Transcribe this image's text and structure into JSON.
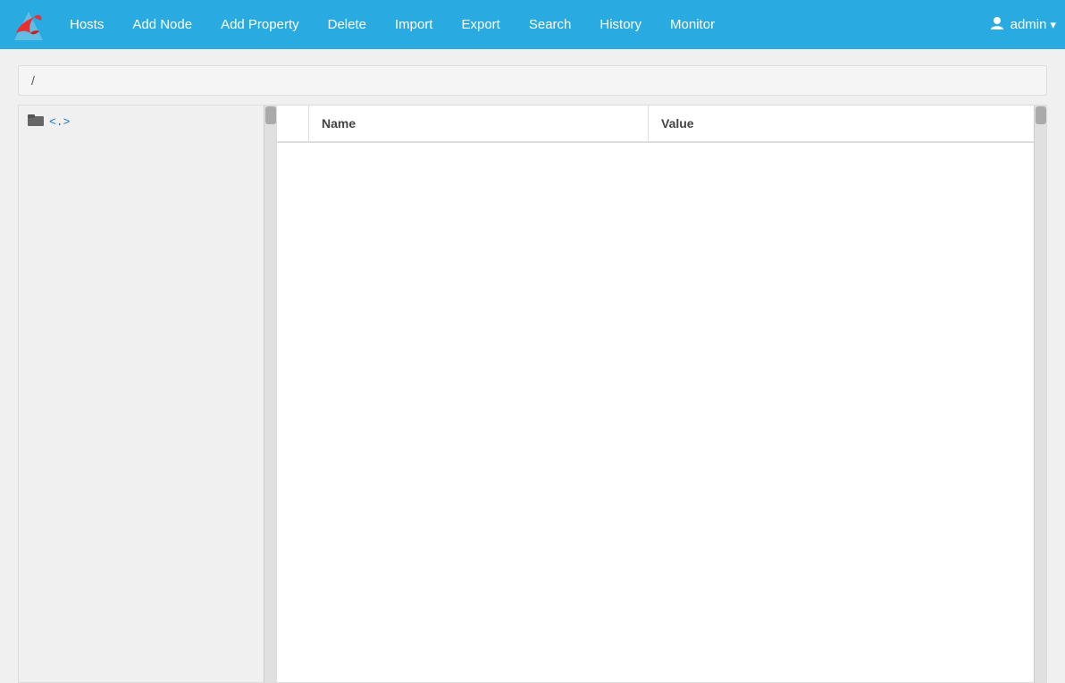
{
  "navbar": {
    "items": [
      {
        "label": "Hosts",
        "id": "hosts"
      },
      {
        "label": "Add Node",
        "id": "add-node"
      },
      {
        "label": "Add Property",
        "id": "add-property"
      },
      {
        "label": "Delete",
        "id": "delete"
      },
      {
        "label": "Import",
        "id": "import"
      },
      {
        "label": "Export",
        "id": "export"
      },
      {
        "label": "Search",
        "id": "search"
      },
      {
        "label": "History",
        "id": "history"
      },
      {
        "label": "Monitor",
        "id": "monitor"
      }
    ],
    "user": {
      "name": "admin",
      "dropdown_icon": "▾"
    }
  },
  "breadcrumb": {
    "path": "/"
  },
  "left_panel": {
    "tree_node": {
      "icon": "🗀",
      "label": "<.>"
    }
  },
  "table": {
    "columns": [
      {
        "id": "name",
        "label": "Name"
      },
      {
        "id": "value",
        "label": "Value"
      }
    ],
    "rows": []
  }
}
